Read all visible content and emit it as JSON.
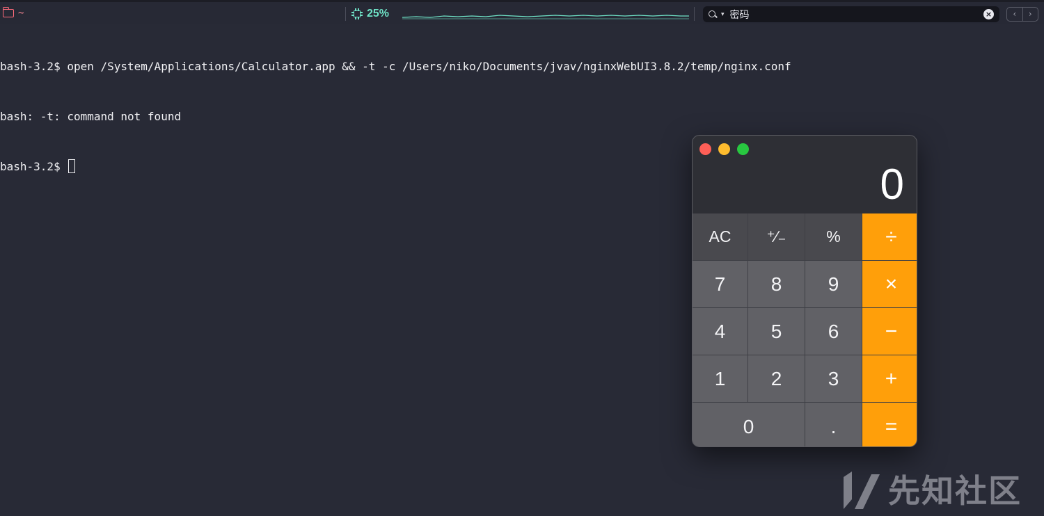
{
  "topbar": {
    "cwd": "~",
    "cpu_percent": "25%",
    "search": {
      "value": "密码"
    },
    "nav": {
      "back": "‹",
      "forward": "›"
    }
  },
  "terminal": {
    "lines": [
      "bash-3.2$ open /System/Applications/Calculator.app && -t -c /Users/niko/Documents/jvav/nginxWebUI3.8.2/temp/nginx.conf",
      "bash: -t: command not found",
      "bash-3.2$ "
    ]
  },
  "calculator": {
    "display": "0",
    "keys": {
      "ac": "AC",
      "sign": "⁺∕₋",
      "percent": "%",
      "divide": "÷",
      "seven": "7",
      "eight": "8",
      "nine": "9",
      "multiply": "×",
      "four": "4",
      "five": "5",
      "six": "6",
      "minus": "−",
      "one": "1",
      "two": "2",
      "three": "3",
      "plus": "+",
      "zero": "0",
      "decimal": ".",
      "equals": "="
    }
  },
  "watermark": {
    "text": "先知社区"
  },
  "colors": {
    "terminal_bg": "#282a36",
    "cpu_accent": "#6fe3c7",
    "path_accent": "#ff8a95",
    "operator_orange": "#ff9f0a"
  }
}
